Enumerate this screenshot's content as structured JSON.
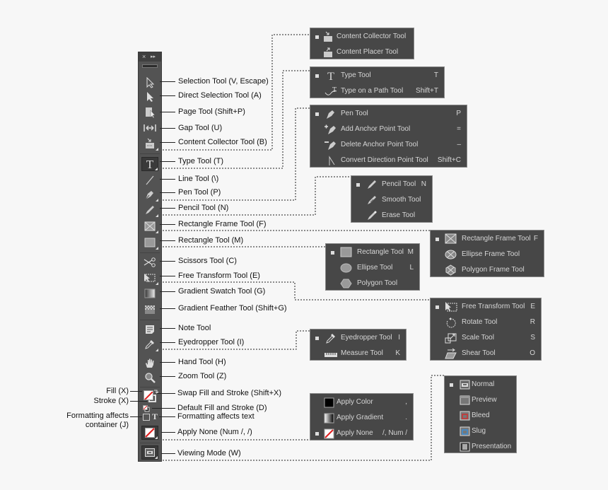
{
  "toolbar": {
    "close_glyph": "×",
    "expand_glyph": "▸▸",
    "tools": [
      {
        "icon": "selection-arrow-icon",
        "label": "Selection Tool  (V, Escape)"
      },
      {
        "icon": "direct-selection-arrow-icon",
        "label": "Direct Selection Tool  (A)"
      },
      {
        "icon": "page-tool-icon",
        "label": "Page Tool (Shift+P)"
      },
      {
        "icon": "gap-tool-icon",
        "label": "Gap Tool (U)"
      },
      {
        "icon": "content-collector-icon",
        "label": "Content Collector Tool (B)"
      },
      {
        "icon": "type-tool-icon",
        "label": "Type Tool (T)"
      },
      {
        "icon": "line-tool-icon",
        "label": "Line Tool (\\)"
      },
      {
        "icon": "pen-tool-icon",
        "label": "Pen Tool (P)"
      },
      {
        "icon": "pencil-tool-icon",
        "label": "Pencil Tool (N)"
      },
      {
        "icon": "rectangle-frame-icon",
        "label": "Rectangle Frame Tool (F)"
      },
      {
        "icon": "rectangle-tool-icon",
        "label": "Rectangle Tool (M)"
      },
      {
        "icon": "scissors-icon",
        "label": "Scissors Tool (C)"
      },
      {
        "icon": "free-transform-icon",
        "label": "Free Transform Tool (E)"
      },
      {
        "icon": "gradient-swatch-icon",
        "label": "Gradient Swatch Tool (G)"
      },
      {
        "icon": "gradient-feather-icon",
        "label": "Gradient Feather Tool (Shift+G)"
      },
      {
        "icon": "note-tool-icon",
        "label": "Note Tool"
      },
      {
        "icon": "eyedropper-icon",
        "label": "Eyedropper Tool (I)"
      },
      {
        "icon": "hand-tool-icon",
        "label": "Hand Tool (H)"
      },
      {
        "icon": "zoom-tool-icon",
        "label": "Zoom Tool (Z)"
      }
    ],
    "color_controls": {
      "fill_label": "Fill (X)",
      "stroke_label": "Stroke (X)",
      "swap_label": "Swap Fill and Stroke (Shift+X)",
      "default_label": "Default Fill and Stroke (D)",
      "formatting_container_label_line1": "Formatting affects",
      "formatting_container_label_line2": "container (J)",
      "formatting_text_label": "Formatting affects text",
      "apply_none_label": "Apply None (Num /, /)",
      "viewing_mode_label": "Viewing Mode (W)"
    }
  },
  "popups": {
    "content": [
      {
        "label": "Content Collector Tool",
        "key": "",
        "active": true
      },
      {
        "label": "Content Placer Tool",
        "key": "",
        "active": false
      }
    ],
    "type": [
      {
        "label": "Type Tool",
        "key": "T",
        "active": true
      },
      {
        "label": "Type on a Path Tool",
        "key": "Shift+T",
        "active": false
      }
    ],
    "pen": [
      {
        "label": "Pen Tool",
        "key": "P",
        "active": true
      },
      {
        "label": "Add Anchor Point Tool",
        "key": "=",
        "active": false
      },
      {
        "label": "Delete Anchor Point Tool",
        "key": "–",
        "active": false
      },
      {
        "label": "Convert Direction Point Tool",
        "key": "Shift+C",
        "active": false
      }
    ],
    "pencil": [
      {
        "label": "Pencil Tool",
        "key": "N",
        "active": true
      },
      {
        "label": "Smooth Tool",
        "key": "",
        "active": false
      },
      {
        "label": "Erase Tool",
        "key": "",
        "active": false
      }
    ],
    "frame": [
      {
        "label": "Rectangle Frame Tool",
        "key": "F",
        "active": true
      },
      {
        "label": "Ellipse Frame Tool",
        "key": "",
        "active": false
      },
      {
        "label": "Polygon Frame Tool",
        "key": "",
        "active": false
      }
    ],
    "shape": [
      {
        "label": "Rectangle Tool",
        "key": "M",
        "active": true
      },
      {
        "label": "Ellipse Tool",
        "key": "L",
        "active": false
      },
      {
        "label": "Polygon Tool",
        "key": "",
        "active": false
      }
    ],
    "transform": [
      {
        "label": "Free Transform Tool",
        "key": "E",
        "active": true
      },
      {
        "label": "Rotate Tool",
        "key": "R",
        "active": false
      },
      {
        "label": "Scale Tool",
        "key": "S",
        "active": false
      },
      {
        "label": "Shear Tool",
        "key": "O",
        "active": false
      }
    ],
    "eyedropper": [
      {
        "label": "Eyedropper Tool",
        "key": "I",
        "active": true
      },
      {
        "label": "Measure Tool",
        "key": "K",
        "active": false
      }
    ],
    "apply": [
      {
        "label": "Apply Color",
        "key": ",",
        "active": false
      },
      {
        "label": "Apply Gradient",
        "key": ".",
        "active": false
      },
      {
        "label": "Apply None",
        "key": "/, Num /",
        "active": true
      }
    ],
    "view": [
      {
        "label": "Normal",
        "key": "",
        "active": true
      },
      {
        "label": "Preview",
        "key": "",
        "active": false
      },
      {
        "label": "Bleed",
        "key": "",
        "active": false
      },
      {
        "label": "Slug",
        "key": "",
        "active": false
      },
      {
        "label": "Presentation",
        "key": "",
        "active": false
      }
    ]
  },
  "colors": {
    "panel_bg": "#474747",
    "toolbar_bg": "#535353",
    "none_slash": "#e02020",
    "bleed_accent": "#d03030",
    "slug_accent": "#3d8fd6"
  }
}
